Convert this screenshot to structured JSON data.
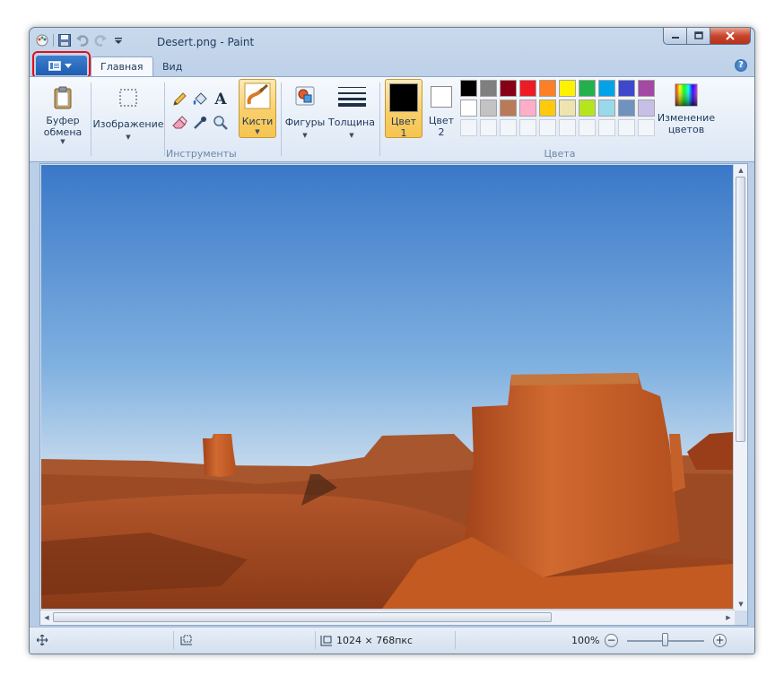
{
  "window": {
    "title": "Desert.png - Paint"
  },
  "tabs": {
    "file_label": "",
    "home": "Главная",
    "view": "Вид"
  },
  "ribbon": {
    "clipboard": {
      "label_line1": "Буфер",
      "label_line2": "обмена"
    },
    "image": {
      "label": "Изображение"
    },
    "tools": {
      "group_label": "Инструменты"
    },
    "brushes": {
      "label": "Кисти"
    },
    "shapes": {
      "label": "Фигуры"
    },
    "size": {
      "label": "Толщина"
    },
    "color1": {
      "label_line1": "Цвет",
      "label_line2": "1",
      "value": "#000000"
    },
    "color2": {
      "label_line1": "Цвет",
      "label_line2": "2",
      "value": "#ffffff"
    },
    "colors": {
      "group_label": "Цвета",
      "row1": [
        "#000000",
        "#7f7f7f",
        "#880015",
        "#ed1c24",
        "#ff7f27",
        "#fff200",
        "#22b14c",
        "#00a2e8",
        "#3f48cc",
        "#a349a4"
      ],
      "row2": [
        "#ffffff",
        "#c3c3c3",
        "#b97a57",
        "#ffaec9",
        "#ffc90e",
        "#efe4b0",
        "#b5e61d",
        "#99d9ea",
        "#7092be",
        "#c8bfe7"
      ]
    },
    "edit_colors": {
      "label_line1": "Изменение",
      "label_line2": "цветов"
    }
  },
  "status": {
    "dimensions": "1024 × 768пкс",
    "zoom": "100%",
    "zoom_level": 0.5
  },
  "accent": {
    "file_button": "#1e5db0",
    "highlight": "#e0101a"
  }
}
